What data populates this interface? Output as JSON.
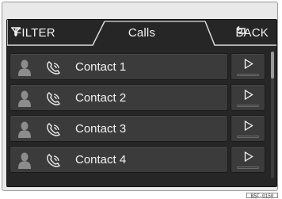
{
  "header": {
    "filter_label": "FILTER",
    "title": "Calls",
    "back_label": "BACK"
  },
  "contacts": [
    {
      "name": "Contact 1"
    },
    {
      "name": "Contact 2"
    },
    {
      "name": "Contact 3"
    },
    {
      "name": "Contact 4"
    }
  ],
  "icons": {
    "filter": "filter-icon",
    "back": "back-arrow-icon",
    "avatar": "person-silhouette-icon",
    "phone": "handset-icon",
    "play": "play-triangle-icon"
  },
  "figure_code": "B5F-0150",
  "colors": {
    "screen_bg": "#262626",
    "row_bg": "#3b3b3b",
    "text": "#f2f2f2"
  }
}
